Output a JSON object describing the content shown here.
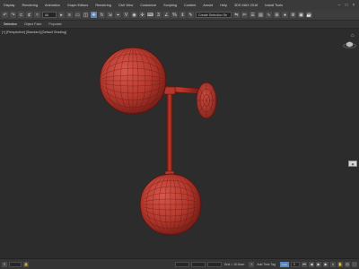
{
  "menubar": {
    "items": [
      "Display",
      "Rendering",
      "Animation",
      "Graph Editors",
      "Rendering",
      "Civil View",
      "Customize",
      "Scripting",
      "Content",
      "Arnold",
      "Help",
      "3DS MAX 2018",
      "Install Tools"
    ]
  },
  "toolbar": {
    "selection_filter": "All",
    "named_selection": "Create Selection Se"
  },
  "ribbon": {
    "tabs": [
      "Selection",
      "Object Paint",
      "Populate"
    ]
  },
  "viewport": {
    "label": "[+] [Perspective] [Standard] [Default Shading]",
    "corner_button": "▦"
  },
  "colors": {
    "model": "#c0392b",
    "model_dark": "#7a1f18",
    "wire": "#5a120d"
  },
  "statusbar": {
    "coord_label": "Grid = 10.0mm",
    "add_time_tag": "Add Time Tag",
    "frame_field": "0",
    "auto_label": "Auto"
  }
}
